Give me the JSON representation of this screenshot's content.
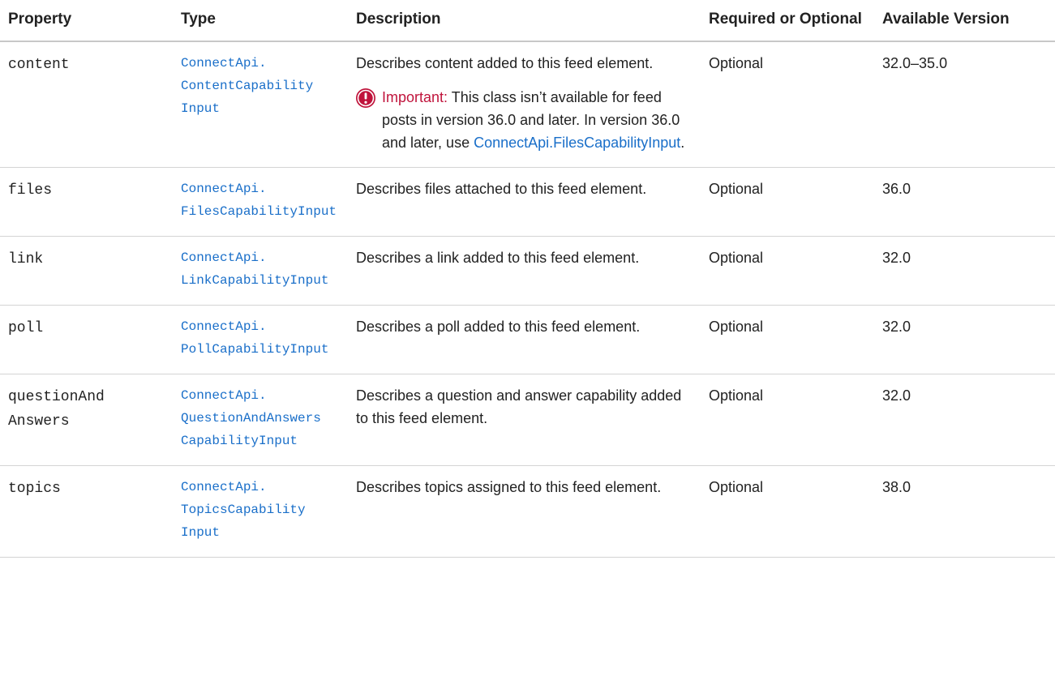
{
  "table": {
    "headers": {
      "property": "Property",
      "type": "Type",
      "description": "Description",
      "required": "Required or Optional",
      "version": "Available Version"
    },
    "rows": [
      {
        "property": "content",
        "type": "ConnectApi.\nContentCapability\nInput",
        "description": "Describes content added to this feed element.",
        "note": {
          "label": "Important:",
          "text_before_link": " This class isn’t available for feed posts in version 36.0 and later. In version 36.0 and later, use ",
          "link": "ConnectApi.FilesCapabilityInput",
          "text_after_link": "."
        },
        "required": "Optional",
        "version": "32.0–35.0"
      },
      {
        "property": "files",
        "type": "ConnectApi.\nFilesCapabilityInput",
        "description": "Describes files attached to this feed element.",
        "required": "Optional",
        "version": "36.0"
      },
      {
        "property": "link",
        "type": "ConnectApi.\nLinkCapabilityInput",
        "description": "Describes a link added to this feed element.",
        "required": "Optional",
        "version": "32.0"
      },
      {
        "property": "poll",
        "type": "ConnectApi.\nPollCapabilityInput",
        "description": "Describes a poll added to this feed element.",
        "required": "Optional",
        "version": "32.0"
      },
      {
        "property": "questionAnd\nAnswers",
        "type": "ConnectApi.\nQuestionAndAnswers\nCapabilityInput",
        "description": "Describes a question and answer capability added to this feed element.",
        "required": "Optional",
        "version": "32.0"
      },
      {
        "property": "topics",
        "type": "ConnectApi.\nTopicsCapability\nInput",
        "description": "Describes topics assigned to this feed element.",
        "required": "Optional",
        "version": "38.0"
      }
    ]
  },
  "colors": {
    "link": "#1a6fc9",
    "important_label": "#c0143c",
    "important_icon": "#c0143c",
    "text": "#222222",
    "rule": "#d4d4d4"
  },
  "icons": {
    "note_icon": "important-icon"
  }
}
